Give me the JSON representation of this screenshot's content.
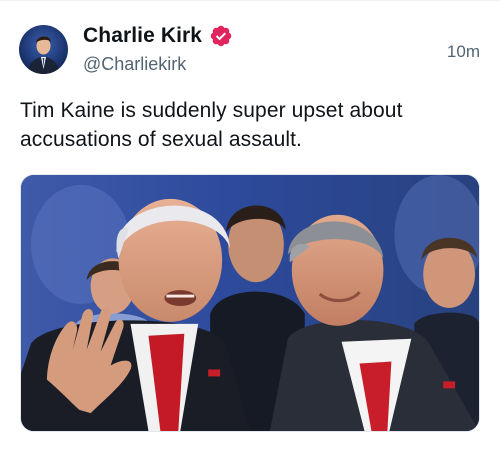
{
  "post": {
    "author": {
      "display_name": "Charlie Kirk",
      "handle": "@Charliekirk",
      "verified_badge_color": "#e0245e",
      "avatar_icon": "profile-avatar"
    },
    "timestamp": "10m",
    "text": "Tim Kaine is suddenly super upset about accusations of sexual assault.",
    "media": {
      "type": "photo",
      "description_icon": "photo-two-men-at-event"
    }
  },
  "colors": {
    "text_primary": "#0f1419",
    "text_secondary": "#536471",
    "badge": "#e0245e"
  }
}
